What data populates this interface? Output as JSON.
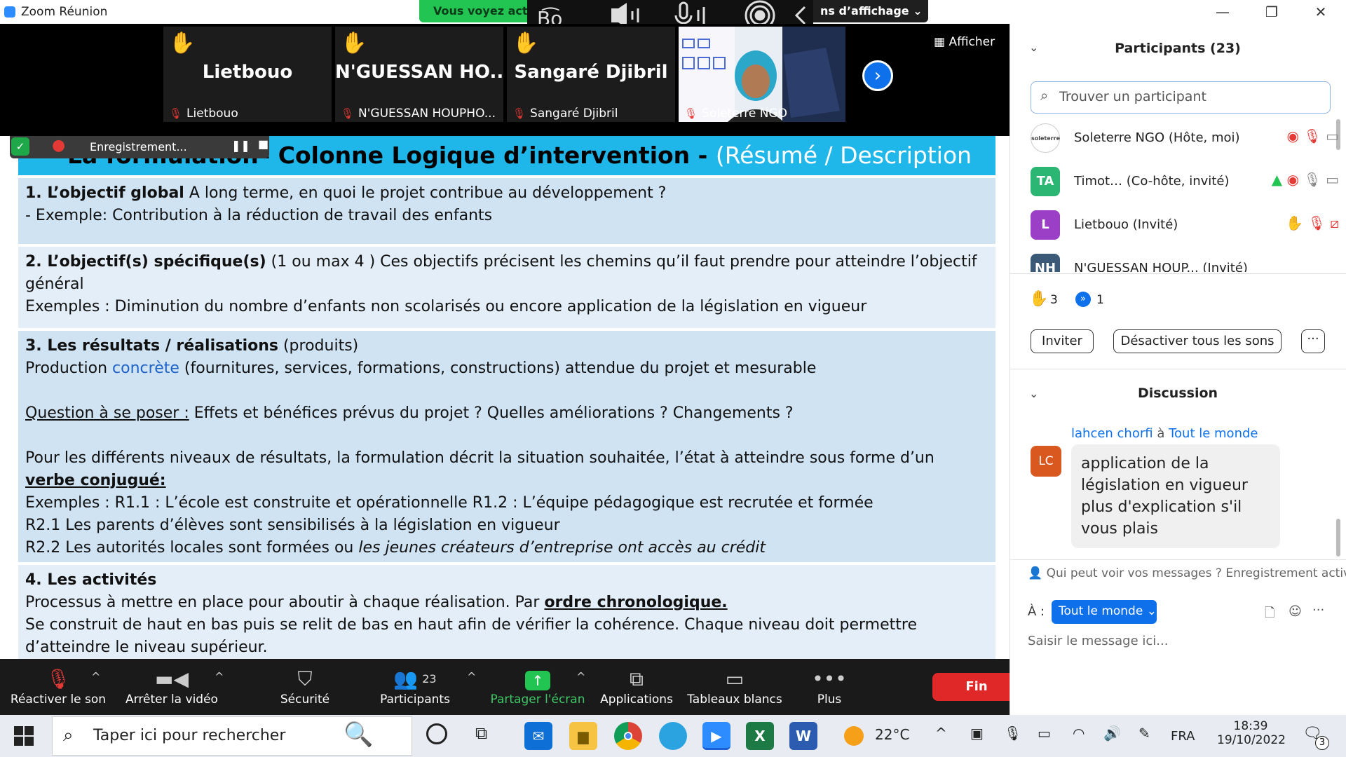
{
  "window": {
    "title": "Zoom Réunion"
  },
  "banner": {
    "viewing": "Vous voyez actu",
    "view_options": "ns d’affichage ⌄"
  },
  "gallery": {
    "tiles": [
      {
        "display": "Lietbouo",
        "footer": "Lietbouo"
      },
      {
        "display": "N'GUESSAN  HO...",
        "footer": "N'GUESSAN HOUPHO..."
      },
      {
        "display": "Sangaré Djibril",
        "footer": "Sangaré Djibril"
      },
      {
        "display": "",
        "footer": "Soleterre NGO"
      }
    ],
    "view_button": "Afficher"
  },
  "recording": {
    "label": "Enregistrement..."
  },
  "slide": {
    "title": "La formulation– Colonne Logique d’intervention - ",
    "title_alt": "(Résumé  / Description",
    "s1_head": "1.   L’objectif global",
    "s1_text": " A long terme, en quoi le projet contribue au développement ?",
    "s1_example": "- Exemple: Contribution à la réduction de travail des enfants",
    "s2_head": "2. L’objectif(s) spécifique(s)",
    "s2_text": " (1 ou max 4 ) Ces objectifs précisent les chemins qu’il faut prendre pour atteindre l’objectif général",
    "s2_example": "Exemples : Diminution du nombre d’enfants non scolarisés ou encore application de la législation en vigueur",
    "s3_head": "3. Les résultats / réalisations",
    "s3_paren": " (produits)",
    "s3_prod_a": "Production ",
    "s3_prod_link": "concrète",
    "s3_prod_b": " (fournitures, services, formations, constructions)  attendue du projet et mesurable",
    "s3_q_label": "Question à se poser :",
    "s3_q_text": " Effets et bénéfices prévus du projet ? Quelles améliorations ? Changements ?",
    "s3_levels_a": "Pour les différents niveaux de résultats, la formulation décrit la situation souhaitée, l’état à atteindre sous forme d’un ",
    "s3_levels_b": "verbe conjugué:",
    "s3_ex1": "Exemples : R1.1 : L’école est construite et opérationnelle R1.2 : L’équipe pédagogique est recrutée et formée",
    "s3_ex2": "R2.1  Les parents d’élèves sont sensibilisés à la législation en vigueur",
    "s3_ex3a": "R2.2 Les autorités locales sont formées ou ",
    "s3_ex3b": "les jeunes créateurs d’entreprise ont accès au crédit",
    "s4_head": "4. Les activités",
    "s4_a": "Processus à mettre en place pour aboutir à chaque réalisation. Par ",
    "s4_b": "ordre chronologique.",
    "s4_c": "Se construit de haut en bas puis se relit de bas en haut afin de vérifier la cohérence. Chaque niveau doit permettre d’atteindre le niveau supérieur."
  },
  "controls": {
    "unmute": "Réactiver le son",
    "stop_video": "Arrêter la vidéo",
    "security": "Sécurité",
    "participants": "Participants",
    "participants_count": "23",
    "share": "Partager l'écran",
    "apps": "Applications",
    "whiteboards": "Tableaux blancs",
    "more": "Plus",
    "end": "Fin"
  },
  "participants_panel": {
    "title": "Participants (23)",
    "search_placeholder": "Trouver un participant",
    "rows": [
      {
        "initials": "soleterre",
        "name": "Soleterre NGO (Hôte, moi)",
        "color": "#ffffff"
      },
      {
        "initials": "TA",
        "name": "Timot…  (Co-hôte, invité)",
        "color": "#2bb673"
      },
      {
        "initials": "L",
        "name": "Lietbouo (Invité)",
        "color": "#9b3fc6"
      },
      {
        "initials": "NH",
        "name": "N'GUESSAN HOUP...  (Invité)",
        "color": "#3a5a78"
      }
    ],
    "raised_hands": "3",
    "fast_count": "1",
    "invite": "Inviter",
    "mute_all": "Désactiver tous les sons",
    "more": "···"
  },
  "chat": {
    "title": "Discussion",
    "sender": "lahcen chorfi",
    "to_word": " à ",
    "recipient": "Tout le monde",
    "avatar": "LC",
    "message": "application de la législation en vigueur plus d'explication s'il vous plais",
    "privacy": "Qui peut voir vos messages ? Enregistrement activé",
    "to_label": "À :",
    "to_value": "Tout le monde ⌄",
    "input_placeholder": "Saisir le message ici..."
  },
  "taskbar": {
    "search": "Taper ici pour rechercher",
    "weather": "22°C",
    "lang": "FRA",
    "time": "18:39",
    "date": "19/10/2022",
    "notifications": "3"
  }
}
